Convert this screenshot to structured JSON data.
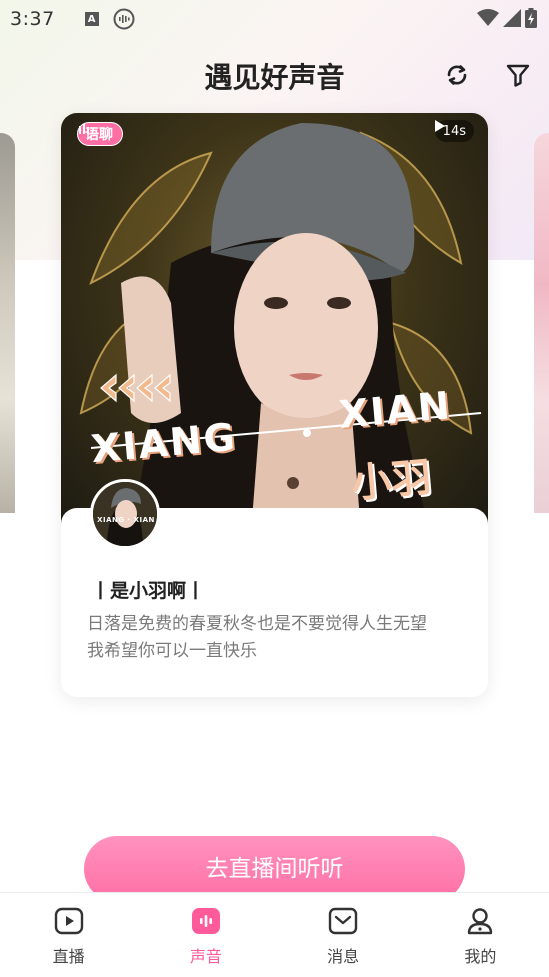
{
  "status_bar": {
    "time": "3:37",
    "a_icon": "A"
  },
  "header": {
    "title": "遇见好声音",
    "refresh_icon": "refresh-icon",
    "filter_icon": "filter-icon"
  },
  "card": {
    "tag": "语聊",
    "duration": "14s",
    "cover_text_left": "XIANG",
    "cover_text_right": "XIAN",
    "cover_text_name": "小羽",
    "avatar_text": "XIANG · XIAN",
    "user_name": "丨是小羽啊丨",
    "bio_line1": "日落是免费的春夏秋冬也是不要觉得人生无望",
    "bio_line2": "我希望你可以一直快乐"
  },
  "cta_label": "去直播间听听",
  "tabs": [
    {
      "label": "直播",
      "icon": "live-play-icon"
    },
    {
      "label": "声音",
      "icon": "voice-wave-icon"
    },
    {
      "label": "消息",
      "icon": "message-icon"
    },
    {
      "label": "我的",
      "icon": "profile-icon"
    }
  ],
  "colors": {
    "accent": "#ff5b9a",
    "tag_bg": "#ff6fa4",
    "cta_top": "#ff93bf",
    "cta_bottom": "#ff6ea5"
  }
}
